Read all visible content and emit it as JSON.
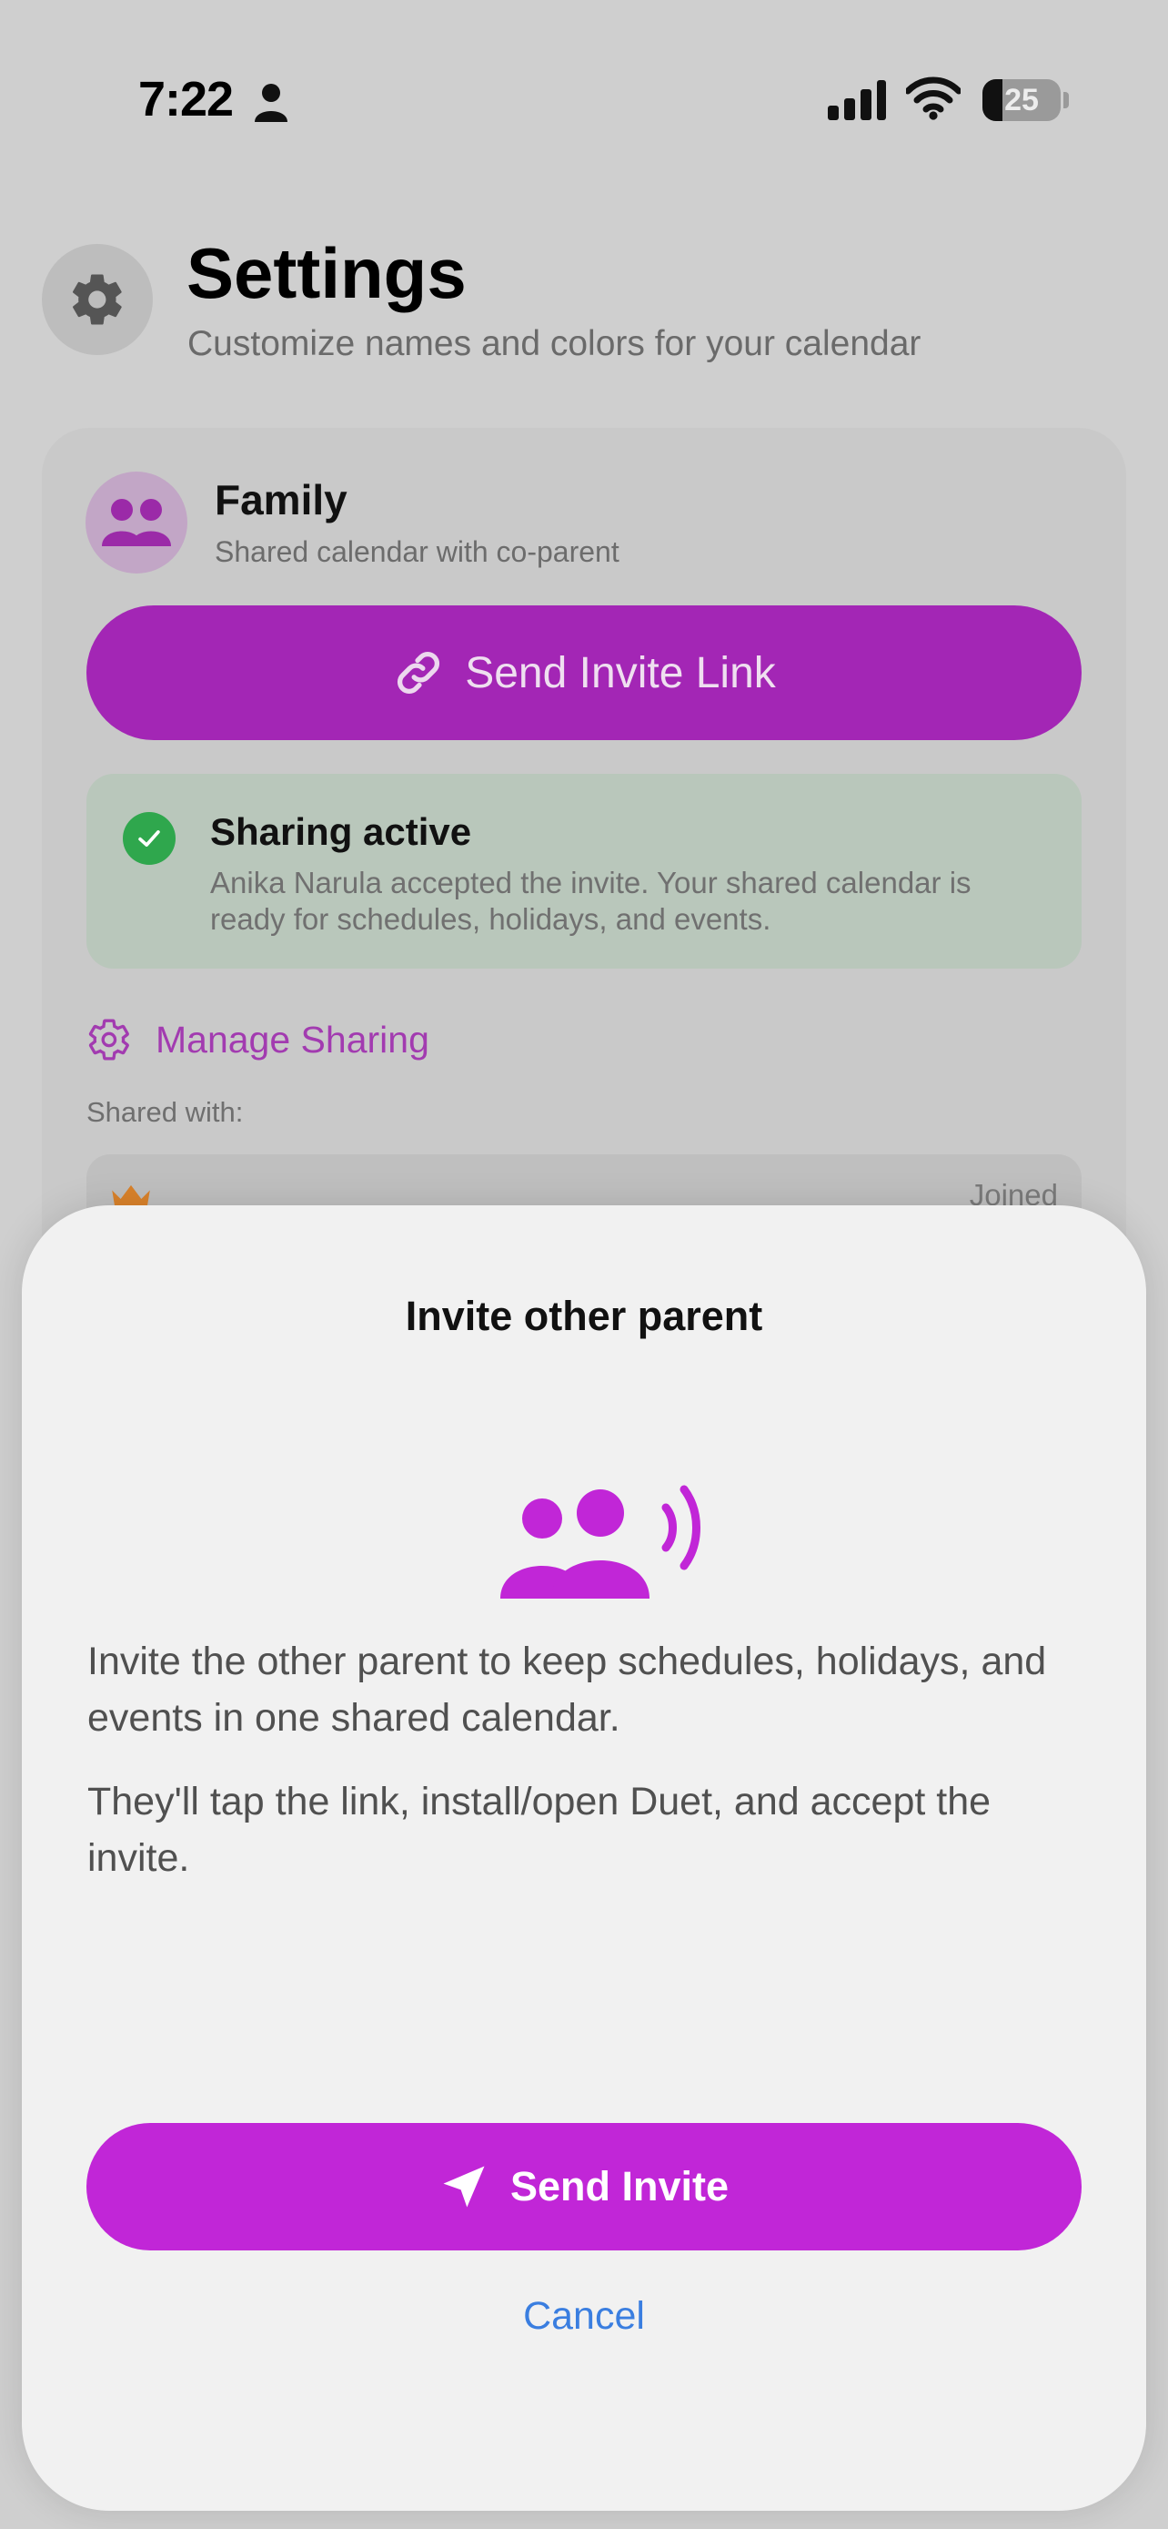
{
  "status_bar": {
    "time": "7:22",
    "battery_level": "25"
  },
  "header": {
    "title": "Settings",
    "subtitle": "Customize names and colors for your calendar"
  },
  "family_card": {
    "name": "Family",
    "description": "Shared calendar with co-parent",
    "invite_button_label": "Send Invite Link",
    "sharing": {
      "title": "Sharing active",
      "message": "Anika Narula accepted the invite. Your shared calendar is ready for schedules, holidays, and events."
    },
    "manage_label": "Manage Sharing",
    "shared_with_label": "Shared with:",
    "member_status": "Joined"
  },
  "sheet": {
    "title": "Invite other parent",
    "paragraph1": "Invite the other parent to keep schedules, holidays, and events in one shared calendar.",
    "paragraph2": "They'll tap the link, install/open Duet, and accept the invite.",
    "send_label": "Send Invite",
    "cancel_label": "Cancel"
  },
  "colors": {
    "accent": "#c126d7",
    "link_blue": "#3a7ee0",
    "success": "#2fa74d"
  }
}
